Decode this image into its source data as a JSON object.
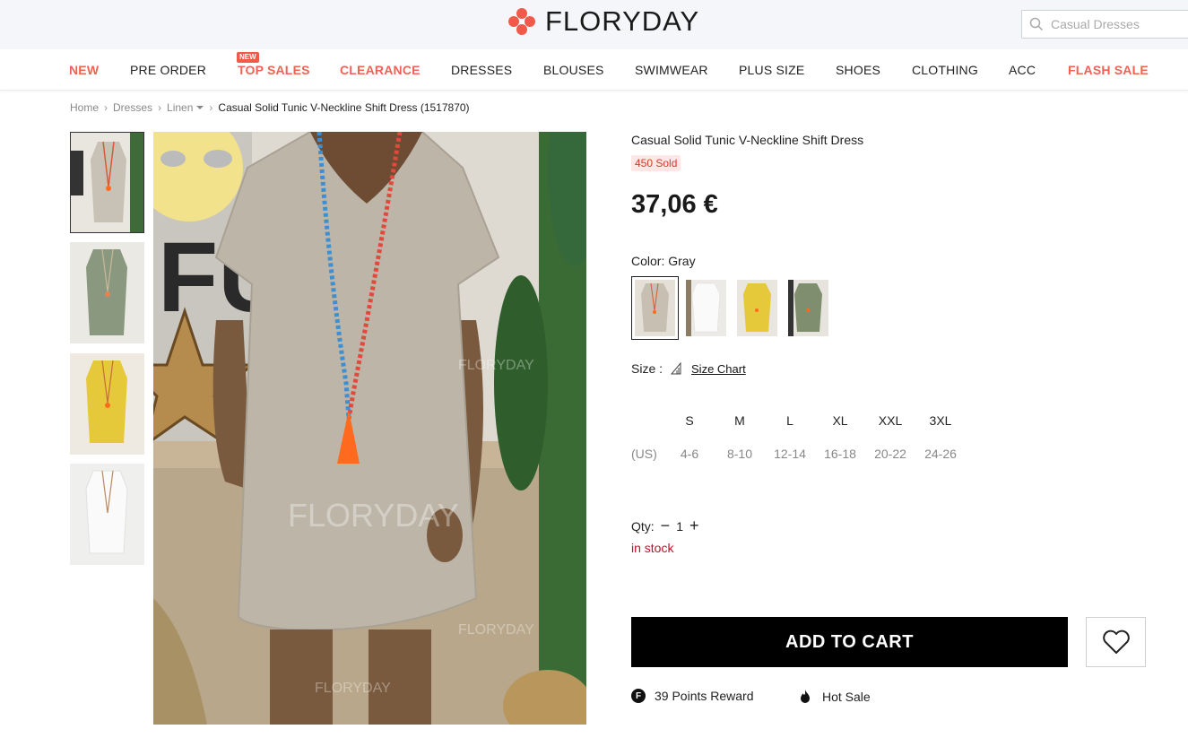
{
  "header": {
    "logo_text": "FLORYDAY",
    "search_placeholder": "Casual Dresses"
  },
  "nav": {
    "items": [
      {
        "label": "NEW",
        "hot": true
      },
      {
        "label": "PRE ORDER",
        "hot": false
      },
      {
        "label": "TOP SALES",
        "hot": true
      },
      {
        "label": "CLEARANCE",
        "hot": true
      },
      {
        "label": "DRESSES",
        "hot": false
      },
      {
        "label": "BLOUSES",
        "hot": false
      },
      {
        "label": "SWIMWEAR",
        "hot": false
      },
      {
        "label": "PLUS SIZE",
        "hot": false
      },
      {
        "label": "SHOES",
        "hot": false
      },
      {
        "label": "CLOTHING",
        "hot": false
      },
      {
        "label": "ACC",
        "hot": false
      },
      {
        "label": "FLASH SALE",
        "hot": true
      }
    ],
    "new_badge": "NEW"
  },
  "breadcrumb": {
    "home": "Home",
    "dresses": "Dresses",
    "linen": "Linen",
    "current": "Casual Solid Tunic V-Neckline Shift Dress (1517870)"
  },
  "product": {
    "title": "Casual Solid Tunic V-Neckline Shift Dress",
    "sold": "450 Sold",
    "price": "37,06 €",
    "color_label": "Color: Gray",
    "colors": [
      "Gray",
      "White",
      "Yellow",
      "Green"
    ],
    "size_label": "Size :",
    "size_chart": "Size Chart",
    "sizes": [
      "S",
      "M",
      "L",
      "XL",
      "XXL",
      "3XL"
    ],
    "us_label": "(US)",
    "us_sizes": [
      "4-6",
      "8-10",
      "12-14",
      "16-18",
      "20-22",
      "24-26"
    ],
    "qty_label": "Qty:",
    "qty_minus": "−",
    "qty_value": "1",
    "qty_plus": "+",
    "stock": "in stock",
    "add_to_cart": "ADD TO CART",
    "points_icon": "F",
    "points": "39 Points Reward",
    "hot_sale": "Hot Sale"
  },
  "colors": {
    "accent": "#f16154",
    "stock": "#c0102a",
    "cart_bg": "#000000"
  }
}
